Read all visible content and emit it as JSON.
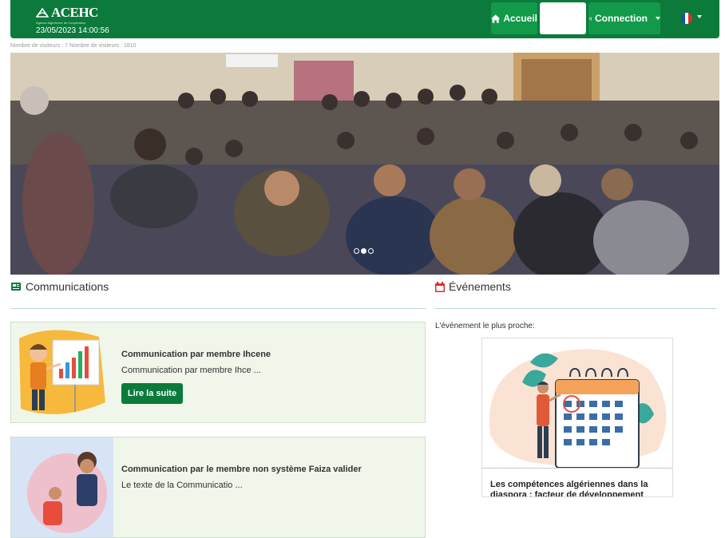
{
  "header": {
    "logo_text": "ACEHC",
    "logo_subtitle": "Agence Algérienne de Coopération",
    "clock": "23/05/2023 14:00:56",
    "nav": {
      "home_label": "Accueil",
      "login_label": "Connection"
    },
    "language_icon": "france-flag-icon"
  },
  "visitors_text": "Nombre de visiteurs : 7 Nombre de visiteurs : 1810",
  "slider": {
    "slide_count": 3,
    "active_slide": 2
  },
  "communications": {
    "title": "Communications",
    "icon": "newspaper-icon",
    "items": [
      {
        "title": "Communication par membre Ihcene",
        "excerpt": "Communication par membre Ihce ...",
        "button_label": "Lire la suite"
      },
      {
        "title": "Communication par le membre non système Faiza valider",
        "excerpt": "Le texte de la Communicatio ..."
      }
    ]
  },
  "events": {
    "title": "Événements",
    "icon": "calendar-icon",
    "nearest_label": "L'événement le plus proche:",
    "nearest_event_title": "Les compétences algériennes dans la diaspora : facteur de développement"
  },
  "colors": {
    "brand_green": "#0b7a3b",
    "nav_button_green": "#129a4a",
    "card_bg": "#f0f6ea",
    "events_icon_red": "#d9312b"
  }
}
